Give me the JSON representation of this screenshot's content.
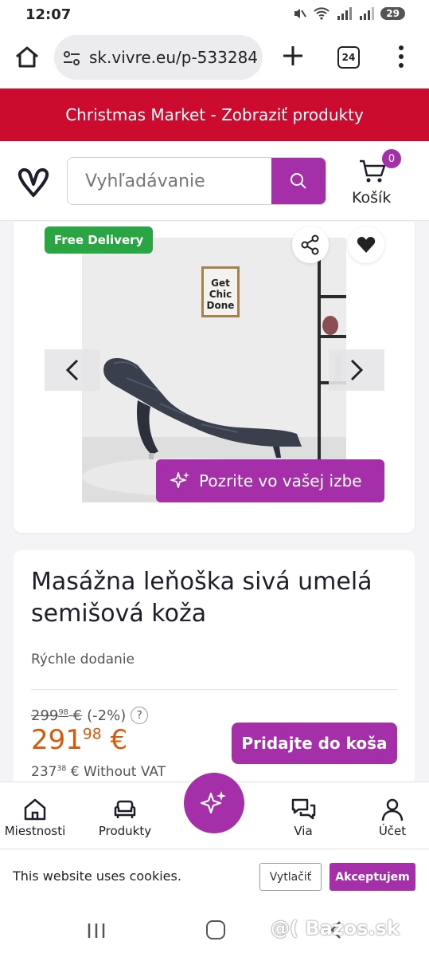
{
  "status_bar": {
    "time": "12:07",
    "battery": "29"
  },
  "browser": {
    "url": "sk.vivre.eu/p-533284",
    "tab_count": "24"
  },
  "promo": {
    "text": "Christmas Market - Zobraziť produkty"
  },
  "header": {
    "search_placeholder": "Vyhľadávanie",
    "cart_count": "0",
    "cart_label": "Košík"
  },
  "gallery": {
    "badge": "Free Delivery",
    "poster_text": [
      "Get",
      "Chic",
      "Done"
    ],
    "room_button": "Pozrite vo vašej izbe"
  },
  "product": {
    "title": "Masážna leňoška sivá umelá semišová koža",
    "delivery_note": "Rýchle dodanie",
    "old_price_int": "299",
    "old_price_dec": "98",
    "currency": "€",
    "discount": "(-2%)",
    "help": "?",
    "price_int": "291",
    "price_dec": "98",
    "novat_int": "237",
    "novat_dec": "38",
    "novat_suffix": "€ Without VAT",
    "add_to_cart": "Pridajte do koša"
  },
  "bottom_nav": {
    "items": [
      {
        "label": "Miestnosti",
        "icon": "home-icon"
      },
      {
        "label": "Produkty",
        "icon": "sofa-icon"
      },
      {
        "label": "",
        "icon": "sparkle-icon"
      },
      {
        "label": "Via",
        "icon": "chat-icon"
      },
      {
        "label": "Účet",
        "icon": "user-icon"
      }
    ]
  },
  "cookies": {
    "text": "This website uses cookies.",
    "decline": "Vytlačiť",
    "accept": "Akceptujem"
  },
  "watermark": "@( Bazos.sk",
  "colors": {
    "brand": "#a52ea9",
    "promo": "#cc0c2f",
    "price": "#d95a0a",
    "badge": "#2aa544"
  }
}
